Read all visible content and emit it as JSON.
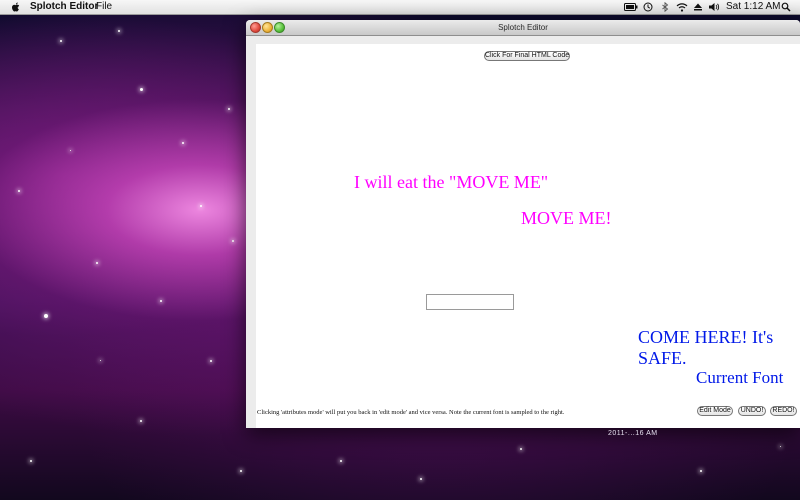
{
  "menubar": {
    "app_name": "Splotch Editor",
    "menus": [
      "File"
    ],
    "clock": "Sat 1:12 AM",
    "status_icons": [
      "battery-icon",
      "time-machine-icon",
      "bluetooth-icon",
      "wifi-icon",
      "eject-icon",
      "volume-icon",
      "spotlight-icon"
    ]
  },
  "window": {
    "title": "Splotch Editor",
    "html_button": "Click For Final HTML Code",
    "texts": {
      "eat": "I will eat the \"MOVE ME\"",
      "move": "MOVE ME!",
      "come": "COME HERE! It's SAFE.",
      "current_font": "Current Font"
    },
    "input_value": "",
    "hint": "Clicking 'attributes mode' will put you back in 'edit mode' and vice versa. Note the current font is sampled to the right.",
    "buttons": {
      "edit_mode": "Edit Mode",
      "undo": "UNDO!",
      "redo": "REDO!"
    },
    "colors": {
      "magenta_text": "#ff00ff",
      "blue_text": "#0018e8"
    }
  },
  "desktop": {
    "file_label": "2011-...16 AM"
  }
}
